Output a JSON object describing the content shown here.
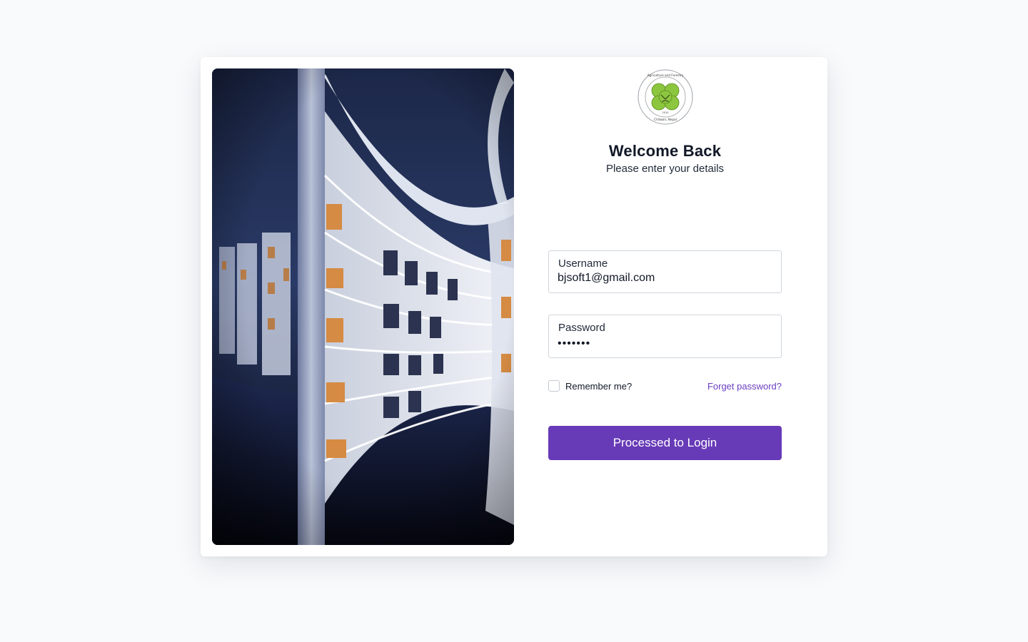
{
  "logo": {
    "name": "university-seal-icon",
    "ring_text_top": "Agriculture and Forestry University",
    "ring_text_bottom": "Chitwan, Nepal",
    "year": "2010",
    "color": "#8cc63f"
  },
  "heading": {
    "title": "Welcome Back",
    "subtitle": "Please enter your details"
  },
  "form": {
    "username": {
      "label": "Username",
      "value": "bjsoft1@gmail.com"
    },
    "password": {
      "label": "Password",
      "value": "•••••••"
    },
    "remember_label": "Remember me?",
    "remember_checked": false,
    "forgot_label": "Forget password?",
    "submit_label": "Processed to Login"
  },
  "colors": {
    "accent": "#673ab7",
    "link": "#6b3fc0",
    "background": "#f8fafc",
    "card": "#ffffff"
  },
  "hero_image": {
    "name": "library-bookshelves-photo"
  }
}
